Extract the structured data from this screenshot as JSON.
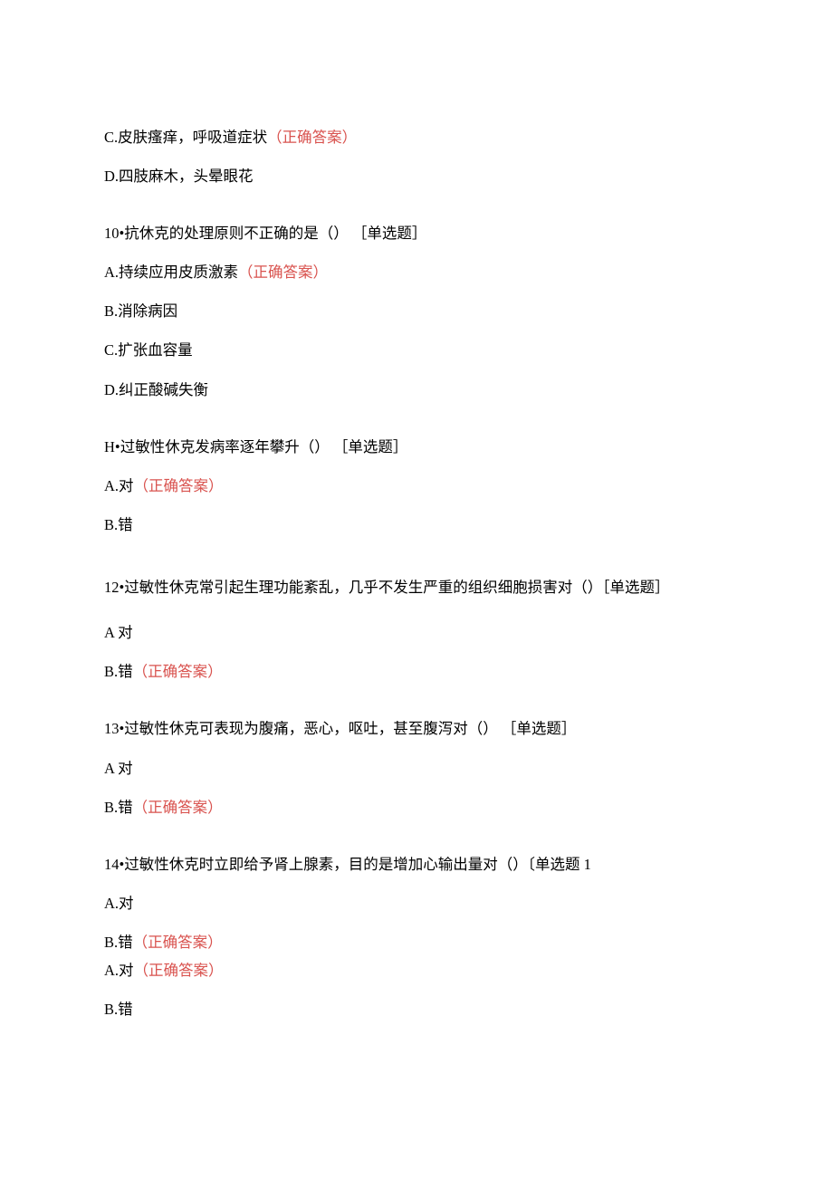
{
  "correctLabel": "（正确答案）",
  "q9": {
    "optC": "C.皮肤瘙痒，呼吸道症状",
    "optD": "D.四肢麻木，头晕眼花"
  },
  "q10": {
    "stem": "10•抗休克的处理原则不正确的是（） ［单选题］",
    "optA": "A.持续应用皮质激素",
    "optB": "B.消除病因",
    "optC": "C.扩张血容量",
    "optD": "D.纠正酸碱失衡"
  },
  "q11": {
    "stem": "H•过敏性休克发病率逐年攀升（） ［单选题］",
    "optA": "A.对",
    "optB": "B.错"
  },
  "q12": {
    "stem": "12•过敏性休克常引起生理功能紊乱，几乎不发生严重的组织细胞损害对（）［单选题］",
    "optA": "A 对",
    "optB": "B.错"
  },
  "q13": {
    "stem": "13•过敏性休克可表现为腹痛，恶心，呕吐，甚至腹泻对（） ［单选题］",
    "optA": "A 对",
    "optB": "B.错"
  },
  "q14": {
    "stem": "14•过敏性休克时立即给予肾上腺素，目的是增加心输出量对（）〔单选题 1",
    "optA": "A.对",
    "optB": "B.错",
    "extraA": "A.对",
    "extraB": "B.错"
  }
}
